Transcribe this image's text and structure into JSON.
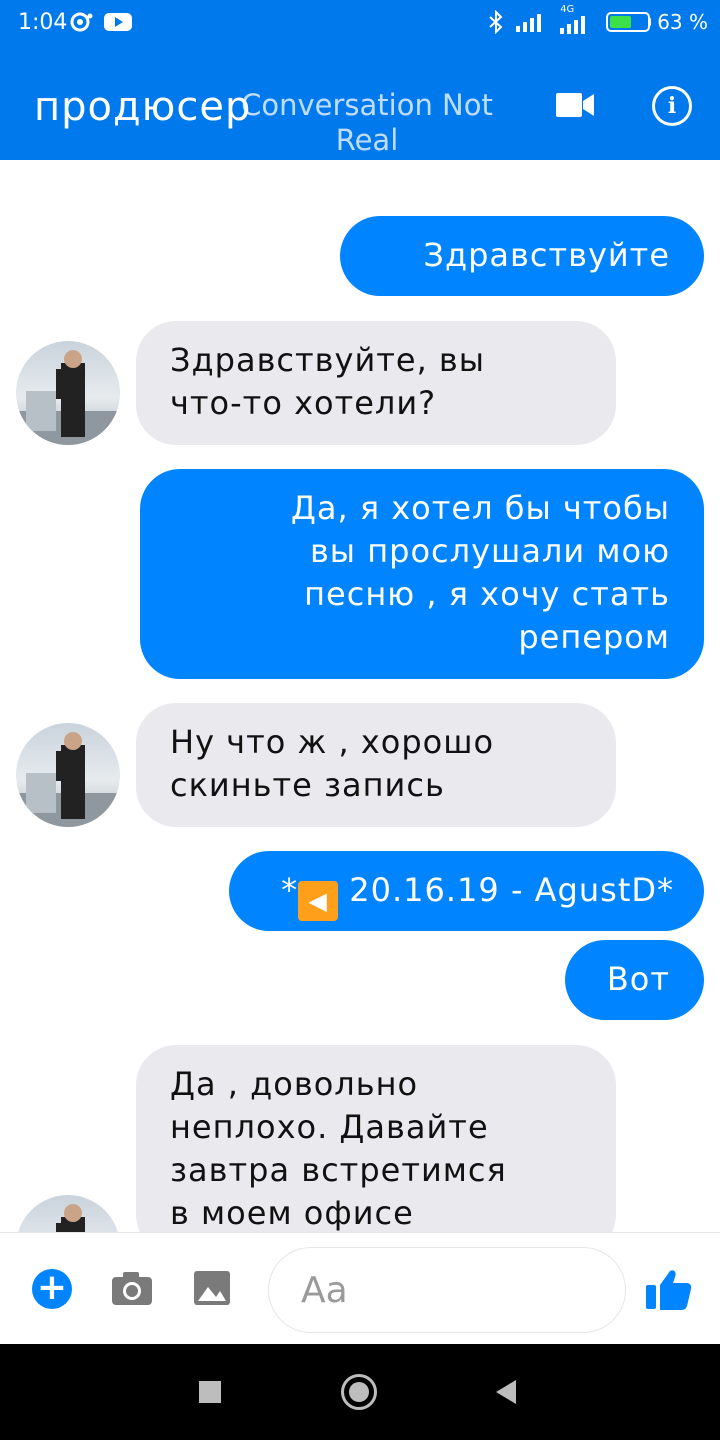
{
  "status_bar": {
    "time": "1:04",
    "network": "4G",
    "battery_percent": "63 %",
    "battery_level": 0.63
  },
  "header": {
    "contact_name": "продюсер",
    "watermark_line1": "Conversation Not",
    "watermark_line2": "Real",
    "icons": [
      "video-camera-icon",
      "info-icon"
    ]
  },
  "messages": [
    {
      "direction": "out",
      "text": "Здравствуйте"
    },
    {
      "direction": "in",
      "lines": [
        "Здравствуйте, вы",
        "что-то хотели?"
      ]
    },
    {
      "direction": "out",
      "lines": [
        "Да, я хотел бы чтобы",
        "вы прослушали мою",
        "песню , я хочу стать",
        "репером"
      ]
    },
    {
      "direction": "in",
      "lines": [
        "Ну что ж , хорошо",
        "скиньте запись"
      ]
    },
    {
      "direction": "out",
      "prefix": "*",
      "play_icon": "◀",
      "text": " 20.16.19 - AgustD*"
    },
    {
      "direction": "out",
      "text": "Вот"
    },
    {
      "direction": "in",
      "lines": [
        "Да , довольно",
        "неплохо. Давайте",
        "завтра встретимся",
        "в моем офисе"
      ]
    }
  ],
  "composer": {
    "placeholder": "Aa",
    "icons": [
      "add-icon",
      "camera-icon",
      "gallery-icon",
      "thumbs-up-icon"
    ]
  },
  "colors": {
    "header_blue": "#0079ec",
    "outgoing_bubble": "#0084ff",
    "incoming_bubble": "#eaeaee"
  }
}
